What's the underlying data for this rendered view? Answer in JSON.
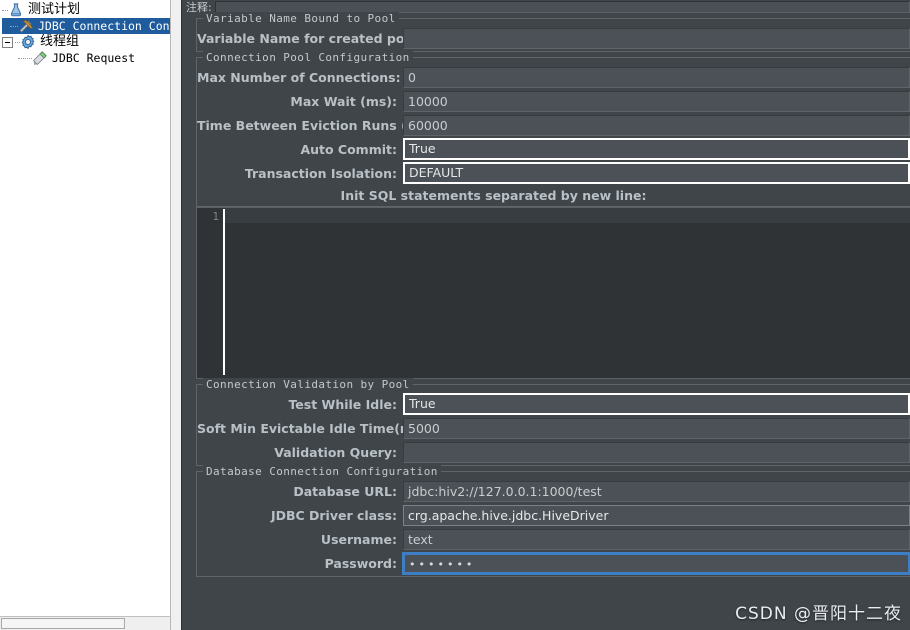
{
  "tree": {
    "nodes": [
      {
        "label": "测试计划",
        "icon": "test-plan-flask-icon",
        "depth": 0,
        "selected": false,
        "expander": false,
        "cjk": true
      },
      {
        "label": "JDBC Connection Config",
        "icon": "jdbc-connection-config-tools-icon",
        "depth": 1,
        "selected": true,
        "expander": false,
        "cjk": false
      },
      {
        "label": "线程组",
        "icon": "thread-group-gear-icon",
        "depth": 0,
        "selected": false,
        "expander": true,
        "cjk": true
      },
      {
        "label": "JDBC Request",
        "icon": "jdbc-request-pipette-icon",
        "depth": 1,
        "selected": false,
        "expander": false,
        "cjk": false
      }
    ]
  },
  "comment": {
    "label": "注释:",
    "value": "",
    "placeholder": ""
  },
  "groups": {
    "variable_name": {
      "legend": "Variable Name Bound to Pool",
      "fields": [
        {
          "label": "Variable Name for created pool:",
          "value": "",
          "style": "plain"
        }
      ]
    },
    "connection_pool": {
      "legend": "Connection Pool Configuration",
      "fields": [
        {
          "label": "Max Number of Connections:",
          "value": "0",
          "style": "plain"
        },
        {
          "label": "Max Wait (ms):",
          "value": "10000",
          "style": "plain"
        },
        {
          "label": "Time Between Eviction Runs (ms):",
          "value": "60000",
          "style": "plain"
        },
        {
          "label": "Auto Commit:",
          "value": "True",
          "style": "combo"
        },
        {
          "label": "Transaction Isolation:",
          "value": "DEFAULT",
          "style": "combo"
        }
      ]
    },
    "init_sql": {
      "caption": "Init SQL statements separated by new line:",
      "line_number": "1",
      "value": ""
    },
    "connection_validation": {
      "legend": "Connection Validation by Pool",
      "fields": [
        {
          "label": "Test While Idle:",
          "value": "True",
          "style": "combo"
        },
        {
          "label": "Soft Min Evictable Idle Time(ms):",
          "value": "5000",
          "style": "plain"
        },
        {
          "label": "Validation Query:",
          "value": "",
          "style": "plain"
        }
      ]
    },
    "database_connection": {
      "legend": "Database Connection Configuration",
      "fields": [
        {
          "label": "Database URL:",
          "value": "jdbc:hiv2://127.0.0.1:1000/test",
          "style": "plain"
        },
        {
          "label": "JDBC Driver class:",
          "value": "crg.apache.hive.jdbc.HiveDriver",
          "style": "strong"
        },
        {
          "label": "Username:",
          "value": "text",
          "style": "plain"
        },
        {
          "label": "Password:",
          "value": "•••••••",
          "style": "focused-password"
        }
      ]
    }
  },
  "watermark": "CSDN @晋阳十二夜",
  "colors": {
    "panel_bg": "#3f4549",
    "field_bg": "#4b5156",
    "label": "#b9c0c6",
    "selection_blue": "#1f5c9e",
    "focus_blue": "#3c7fc4",
    "editor_bg": "#2f3336"
  }
}
